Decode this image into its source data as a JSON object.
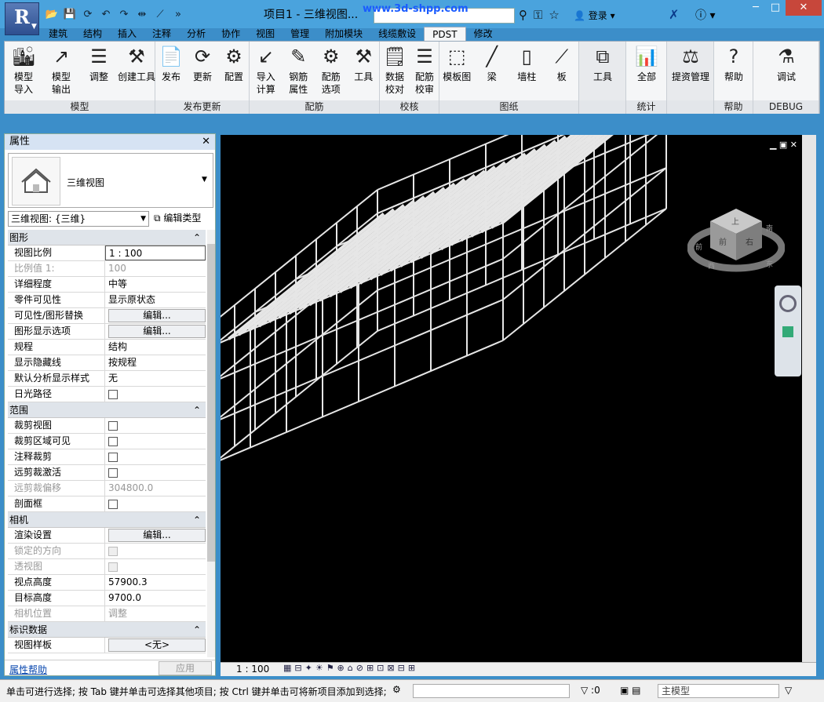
{
  "title": {
    "document": "项目1 - 三维视图...",
    "watermark": "www.3d-shpp.com",
    "login": "登录"
  },
  "menu_tabs": [
    "建筑",
    "结构",
    "插入",
    "注释",
    "分析",
    "协作",
    "视图",
    "管理",
    "附加模块",
    "线缆敷设",
    "PDST",
    "修改"
  ],
  "ribbon": {
    "panels": [
      {
        "label": "模型",
        "buttons": [
          "模型\n导入",
          "模型\n输出",
          "调整",
          "创建工具"
        ]
      },
      {
        "label": "发布更新",
        "buttons": [
          "发布",
          "更新",
          "配置"
        ]
      },
      {
        "label": "配筋",
        "buttons": [
          "导入\n计算",
          "钢筋\n属性",
          "配筋\n选项",
          "工具"
        ]
      },
      {
        "label": "校核",
        "buttons": [
          "数据\n校对",
          "配筋\n校审"
        ]
      },
      {
        "label": "图纸",
        "buttons": [
          "模板图",
          "梁",
          "墙柱",
          "板"
        ]
      },
      {
        "label": "",
        "buttons": [
          "工具"
        ]
      },
      {
        "label": "统计",
        "buttons": [
          "全部"
        ]
      },
      {
        "label": "",
        "buttons": [
          "提资管理"
        ]
      },
      {
        "label": "帮助",
        "buttons": [
          "帮助"
        ]
      },
      {
        "label": "DEBUG",
        "buttons": [
          "调试"
        ]
      }
    ]
  },
  "properties": {
    "header": "属性",
    "type_name": "三维视图",
    "filter": "三维视图: {三维}",
    "edit_type": "编辑类型",
    "help": "属性帮助",
    "apply": "应用",
    "sections": [
      {
        "title": "图形",
        "rows": [
          {
            "k": "视图比例",
            "v": "1 : 100",
            "kind": "input"
          },
          {
            "k": "比例值 1:",
            "v": "100",
            "kind": "dim"
          },
          {
            "k": "详细程度",
            "v": "中等",
            "kind": "text"
          },
          {
            "k": "零件可见性",
            "v": "显示原状态",
            "kind": "text"
          },
          {
            "k": "可见性/图形替换",
            "v": "编辑...",
            "kind": "button"
          },
          {
            "k": "图形显示选项",
            "v": "编辑...",
            "kind": "button"
          },
          {
            "k": "规程",
            "v": "结构",
            "kind": "text"
          },
          {
            "k": "显示隐藏线",
            "v": "按规程",
            "kind": "text"
          },
          {
            "k": "默认分析显示样式",
            "v": "无",
            "kind": "text"
          },
          {
            "k": "日光路径",
            "v": "",
            "kind": "check"
          }
        ]
      },
      {
        "title": "范围",
        "rows": [
          {
            "k": "裁剪视图",
            "v": "",
            "kind": "check"
          },
          {
            "k": "裁剪区域可见",
            "v": "",
            "kind": "check"
          },
          {
            "k": "注释裁剪",
            "v": "",
            "kind": "check"
          },
          {
            "k": "远剪裁激活",
            "v": "",
            "kind": "check"
          },
          {
            "k": "远剪裁偏移",
            "v": "304800.0",
            "kind": "dim"
          },
          {
            "k": "剖面框",
            "v": "",
            "kind": "check"
          }
        ]
      },
      {
        "title": "相机",
        "rows": [
          {
            "k": "渲染设置",
            "v": "编辑...",
            "kind": "button"
          },
          {
            "k": "锁定的方向",
            "v": "",
            "kind": "dimcheck"
          },
          {
            "k": "透视图",
            "v": "",
            "kind": "dimcheck"
          },
          {
            "k": "视点高度",
            "v": "57900.3",
            "kind": "text"
          },
          {
            "k": "目标高度",
            "v": "9700.0",
            "kind": "text"
          },
          {
            "k": "相机位置",
            "v": "调整",
            "kind": "dim"
          }
        ]
      },
      {
        "title": "标识数据",
        "rows": [
          {
            "k": "视图样板",
            "v": "<无>",
            "kind": "button"
          }
        ]
      }
    ]
  },
  "viewcube": {
    "top": "上",
    "front": "前",
    "right": "右",
    "compass": [
      "前",
      "东",
      "西",
      "南"
    ]
  },
  "viewbar": {
    "scale": "1 : 100"
  },
  "status": {
    "text": "单击可进行选择; 按 Tab 键并单击可选择其他项目; 按 Ctrl 键并单击可将新项目添加到选择;",
    "selection_count": ":0",
    "model": "主模型"
  }
}
